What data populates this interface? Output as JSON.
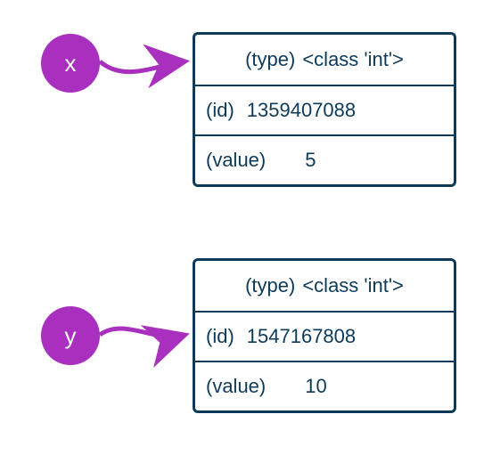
{
  "colors": {
    "circle": "#a92fbf",
    "arrow": "#a92fbf",
    "box_border": "#0e3a5a",
    "text": "#0e3a5a"
  },
  "variables": [
    {
      "name": "x",
      "object": {
        "type_label": "(type)",
        "type_value": "<class 'int'>",
        "id_label": "(id)",
        "id_value": "1359407088",
        "value_label": "(value)",
        "value_value": "5"
      }
    },
    {
      "name": "y",
      "object": {
        "type_label": "(type)",
        "type_value": "<class 'int'>",
        "id_label": "(id)",
        "id_value": "1547167808",
        "value_label": "(value)",
        "value_value": "10"
      }
    }
  ]
}
